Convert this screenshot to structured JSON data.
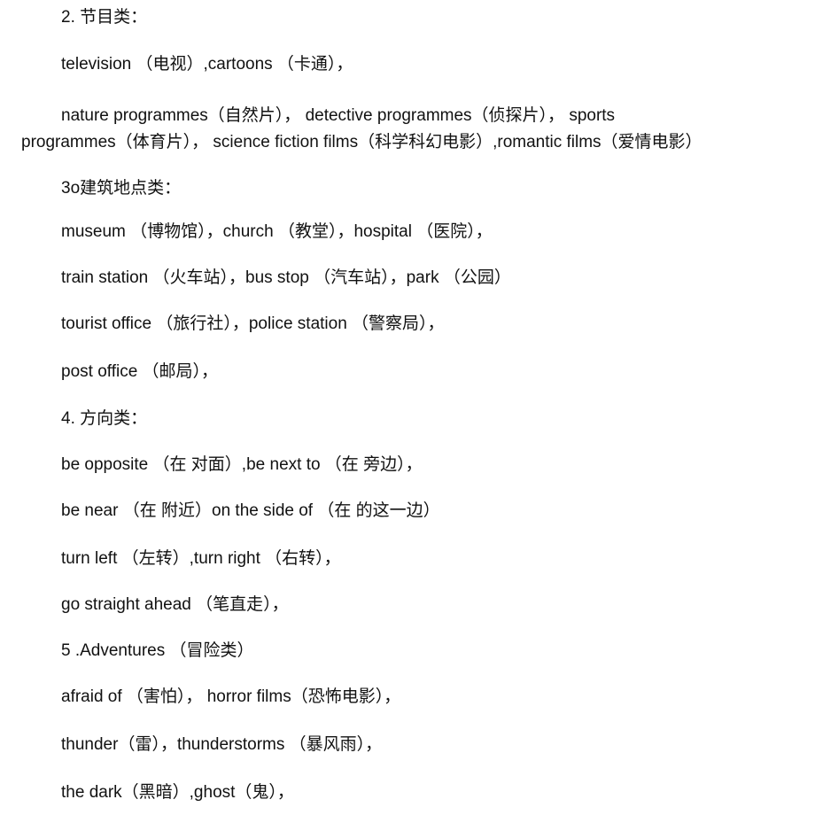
{
  "document": {
    "lines": [
      {
        "id": "heading-2",
        "text": "2. 节目类："
      },
      {
        "id": "line-tv",
        "text": "television （电视）,cartoons （卡通），"
      },
      {
        "id": "line-programmes-1",
        "text": "nature programmes（自然片）， detective programmes（侦探片）， sports"
      },
      {
        "id": "line-programmes-2",
        "text": "programmes（体育片）， science fiction films（科学科幻电影）,romantic films（爱情电影）"
      },
      {
        "id": "heading-3",
        "text": "3o建筑地点类："
      },
      {
        "id": "line-museum",
        "text": "museum （博物馆），church （教堂），hospital （医院），"
      },
      {
        "id": "line-train",
        "text": "train station （火车站），bus stop （汽车站），park （公园）"
      },
      {
        "id": "line-tourist",
        "text": "tourist office （旅行社），police station （警察局），"
      },
      {
        "id": "line-post",
        "text": "post office （邮局），"
      },
      {
        "id": "heading-4",
        "text": "4. 方向类："
      },
      {
        "id": "line-opposite",
        "text": "be opposite （在  对面）,be next to （在  旁边），"
      },
      {
        "id": "line-near",
        "text": "be near （在  附近）on the side of （在  的这一边）"
      },
      {
        "id": "line-turn",
        "text": "turn left （左转）,turn right （右转），"
      },
      {
        "id": "line-straight",
        "text": "go straight ahead （笔直走），"
      },
      {
        "id": "heading-5",
        "text": "5 .Adventures （冒险类）"
      },
      {
        "id": "line-afraid",
        "text": "afraid of （害怕）， horror films（恐怖电影），"
      },
      {
        "id": "line-thunder",
        "text": "thunder（雷），thunderstorms （暴风雨），"
      },
      {
        "id": "line-dark",
        "text": "the dark（黑暗）,ghost（鬼），"
      }
    ]
  }
}
